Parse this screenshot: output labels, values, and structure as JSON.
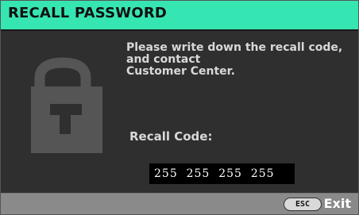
{
  "dialog": {
    "title": "RECALL PASSWORD",
    "message_lines": [
      "Please write down the recall code,",
      "and contact",
      "Customer Center."
    ],
    "recall_code_label": "Recall Code:",
    "recall_code_value": "255  255  255  255",
    "lock_icon": "lock-icon"
  },
  "footer": {
    "esc_key_label": "ESC",
    "exit_label": "Exit"
  },
  "colors": {
    "title_bar": "#36e6b2",
    "background": "#2f2f2f",
    "footer": "#8a8a8a",
    "lock_icon": "#555555"
  }
}
